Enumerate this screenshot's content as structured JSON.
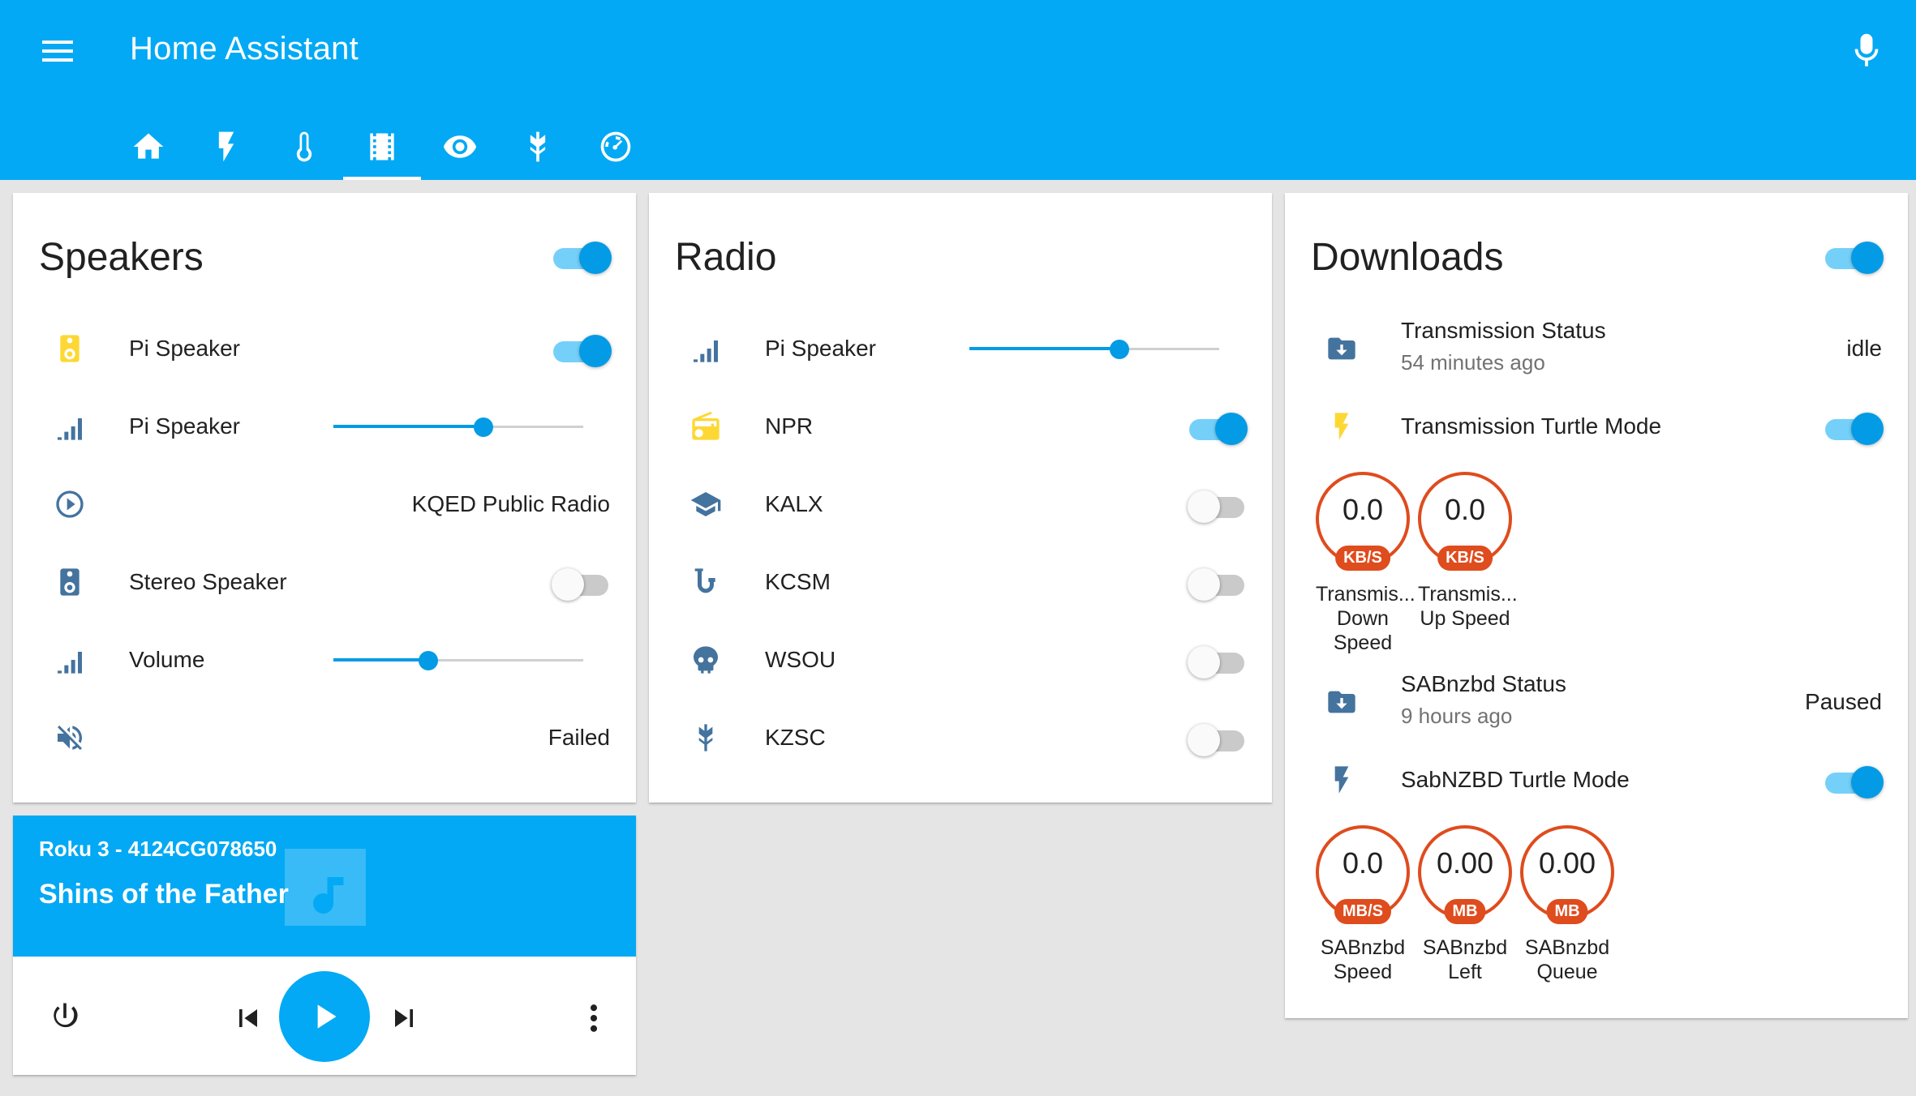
{
  "header": {
    "title": "Home Assistant",
    "tabs": [
      {
        "icon": "home-icon"
      },
      {
        "icon": "flash-icon"
      },
      {
        "icon": "thermometer-icon"
      },
      {
        "icon": "film-icon",
        "active": true
      },
      {
        "icon": "eye-icon"
      },
      {
        "icon": "wheat-icon"
      },
      {
        "icon": "gauge-icon"
      }
    ]
  },
  "colors": {
    "primary": "#03a9f4",
    "accent": "#039be5",
    "icon": "#44739e",
    "yellow": "#fdd835",
    "gauge": "#df4c1e"
  },
  "speakers": {
    "title": "Speakers",
    "rows": [
      {
        "name": "Pi Speaker",
        "type": "toggle",
        "on": true
      },
      {
        "name": "Pi Speaker",
        "type": "slider",
        "level": 0.6
      },
      {
        "state": "KQED Public Radio"
      },
      {
        "name": "Stereo Speaker",
        "type": "toggle",
        "on": false
      },
      {
        "name": "Volume",
        "type": "slider",
        "level": 0.38
      },
      {
        "state": "Failed"
      }
    ]
  },
  "radio": {
    "title": "Radio",
    "rows": [
      {
        "name": "Pi Speaker",
        "type": "slider",
        "level": 0.6
      },
      {
        "name": "NPR",
        "type": "toggle",
        "on": true
      },
      {
        "name": "KALX",
        "type": "toggle",
        "on": false
      },
      {
        "name": "KCSM",
        "type": "toggle",
        "on": false
      },
      {
        "name": "WSOU",
        "type": "toggle",
        "on": false
      },
      {
        "name": "KZSC",
        "type": "toggle",
        "on": false
      }
    ]
  },
  "downloads": {
    "title": "Downloads",
    "transmission_status": {
      "name": "Transmission Status",
      "sub": "54 minutes ago",
      "state": "idle"
    },
    "transmission_turtle": {
      "name": "Transmission Turtle Mode"
    },
    "gauges1": [
      {
        "value": "0.0",
        "unit": "KB/S",
        "label1": "Transmis...",
        "label2": "Down",
        "label3": "Speed"
      },
      {
        "value": "0.0",
        "unit": "KB/S",
        "label1": "Transmis...",
        "label2": "Up Speed",
        "label3": ""
      }
    ],
    "sabnzbd_status": {
      "name": "SABnzbd Status",
      "sub": "9 hours ago",
      "state": "Paused"
    },
    "sabnzbd_turtle": {
      "name": "SabNZBD Turtle Mode"
    },
    "gauges2": [
      {
        "value": "0.0",
        "unit": "MB/S",
        "label1": "SABnzbd",
        "label2": "Speed"
      },
      {
        "value": "0.00",
        "unit": "MB",
        "label1": "SABnzbd",
        "label2": "Left"
      },
      {
        "value": "0.00",
        "unit": "MB",
        "label1": "SABnzbd",
        "label2": "Queue"
      }
    ]
  },
  "media": {
    "device": "Roku 3 - 4124CG078650",
    "title": "Shins of the Father"
  }
}
